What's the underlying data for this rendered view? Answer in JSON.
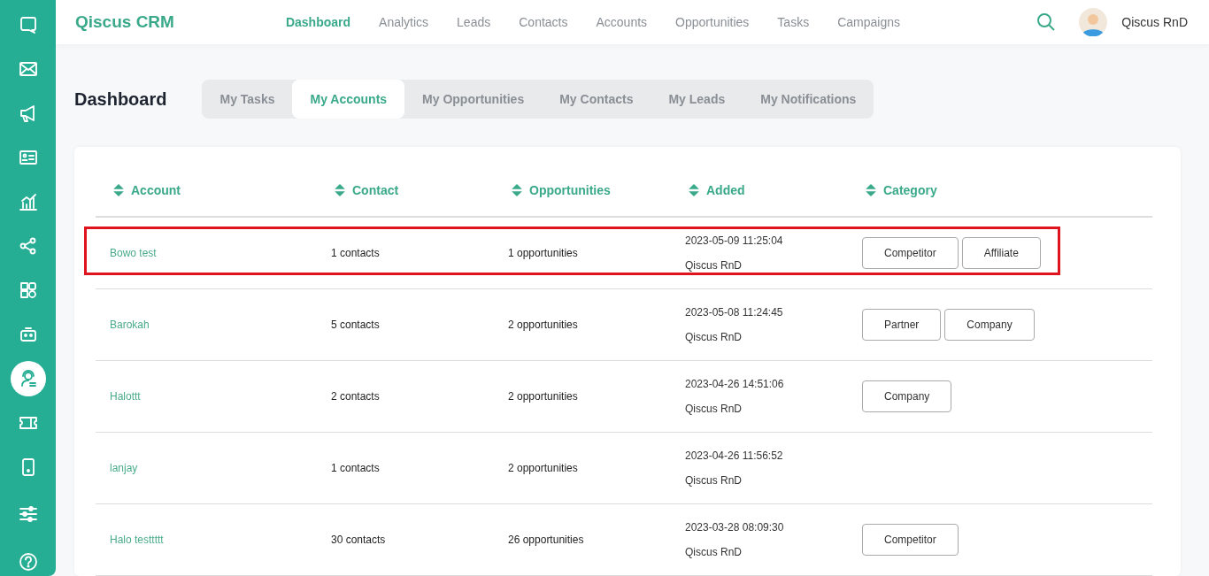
{
  "sidebar": {
    "items": [
      {
        "kind": "chat",
        "selected": false
      },
      {
        "kind": "mail",
        "selected": false
      },
      {
        "kind": "megaphone",
        "selected": false
      },
      {
        "kind": "card",
        "selected": false
      },
      {
        "kind": "chart",
        "selected": false
      },
      {
        "kind": "share",
        "selected": false
      },
      {
        "kind": "grid",
        "selected": false
      },
      {
        "kind": "robot",
        "selected": false
      },
      {
        "kind": "agent",
        "selected": true
      },
      {
        "kind": "ticket",
        "selected": false
      },
      {
        "kind": "phone",
        "selected": false
      }
    ],
    "bottom": [
      {
        "kind": "sliders"
      },
      {
        "kind": "help"
      }
    ]
  },
  "header": {
    "brand": "Qiscus CRM",
    "nav": [
      {
        "label": "Dashboard",
        "selected": true
      },
      {
        "label": "Analytics",
        "selected": false
      },
      {
        "label": "Leads",
        "selected": false
      },
      {
        "label": "Contacts",
        "selected": false
      },
      {
        "label": "Accounts",
        "selected": false
      },
      {
        "label": "Opportunities",
        "selected": false
      },
      {
        "label": "Tasks",
        "selected": false
      },
      {
        "label": "Campaigns",
        "selected": false
      }
    ],
    "user": "Qiscus RnD"
  },
  "page_title": "Dashboard",
  "tabs": [
    {
      "label": "My Tasks",
      "selected": false
    },
    {
      "label": "My Accounts",
      "selected": true
    },
    {
      "label": "My Opportunities",
      "selected": false
    },
    {
      "label": "My Contacts",
      "selected": false
    },
    {
      "label": "My Leads",
      "selected": false
    },
    {
      "label": "My Notifications",
      "selected": false
    }
  ],
  "table": {
    "columns": [
      "Account",
      "Contact",
      "Opportunities",
      "Added",
      "Category"
    ],
    "rows": [
      {
        "account": "Bowo test",
        "contact": "1 contacts",
        "opportunities": "1 opportunities",
        "added": "2023-05-09 11:25:04",
        "added_by": "Qiscus RnD",
        "categories": [
          "Competitor",
          "Affiliate"
        ],
        "highlighted": true
      },
      {
        "account": "Barokah",
        "contact": "5 contacts",
        "opportunities": "2 opportunities",
        "added": "2023-05-08 11:24:45",
        "added_by": "Qiscus RnD",
        "categories": [
          "Partner",
          "Company"
        ],
        "highlighted": false
      },
      {
        "account": "Halottt",
        "contact": "2 contacts",
        "opportunities": "2 opportunities",
        "added": "2023-04-26 14:51:06",
        "added_by": "Qiscus RnD",
        "categories": [
          "Company"
        ],
        "highlighted": false
      },
      {
        "account": "lanjay",
        "contact": "1 contacts",
        "opportunities": "2 opportunities",
        "added": "2023-04-26 11:56:52",
        "added_by": "Qiscus RnD",
        "categories": [],
        "highlighted": false
      },
      {
        "account": "Halo testtttt",
        "contact": "30 contacts",
        "opportunities": "26 opportunities",
        "added": "2023-03-28 08:09:30",
        "added_by": "Qiscus RnD",
        "categories": [
          "Competitor"
        ],
        "highlighted": false
      }
    ]
  }
}
